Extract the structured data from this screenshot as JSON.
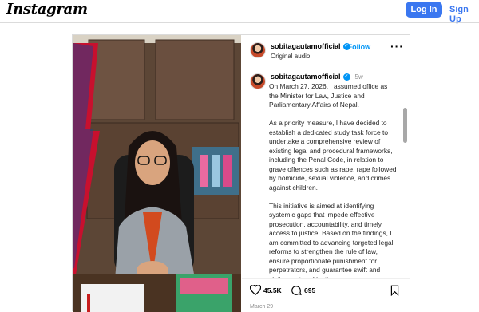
{
  "header": {
    "logo": "Instagram",
    "login": "Log In",
    "signup": "Sign Up"
  },
  "post": {
    "username": "sobitagautamofficial",
    "follow": "Follow",
    "audio": "Original audio",
    "time_ago": "5w",
    "caption": [
      "On March 27, 2026, I assumed office as the Minister for Law, Justice and Parliamentary Affairs of Nepal.",
      "As a priority measure, I have decided to establish a dedicated study task force to undertake a comprehensive review of existing legal and procedural frameworks, including the Penal Code, in relation to grave offences such as rape, rape followed by homicide, sexual violence, and crimes against children.",
      "This initiative is aimed at identifying systemic gaps that impede effective prosecution, accountability, and timely access to justice. Based on the findings, I am committed to advancing targeted legal reforms to strengthen the rule of law, ensure proportionate punishment for perpetrators, and guarantee swift and victim-centered justice."
    ],
    "likes": "45.5K",
    "comments": "695",
    "date": "March 29"
  },
  "icons": [
    "heart-icon",
    "comment-icon",
    "bookmark-icon",
    "more-icon",
    "verified-icon"
  ],
  "colors": {
    "accent": "#3a77f0",
    "link": "#0095f6"
  }
}
